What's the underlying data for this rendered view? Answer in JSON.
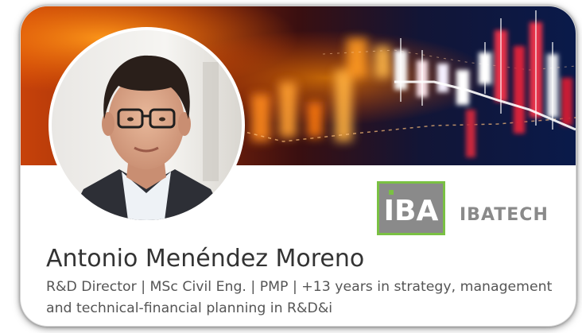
{
  "profile": {
    "name": "Antonio Menéndez Moreno",
    "headline": "R&D Director | MSc Civil Eng. | PMP | +13 years in strategy, management and technical-financial planning in R&D&i"
  },
  "company": {
    "logo_text": "IBA",
    "name": "IBATECH",
    "logo_colors": {
      "box": "#8a8a8a",
      "border": "#7ac143",
      "letters": "#ffffff"
    }
  },
  "icons": {
    "banner": "financial-candlestick-chart-image",
    "avatar": "profile-photo"
  }
}
